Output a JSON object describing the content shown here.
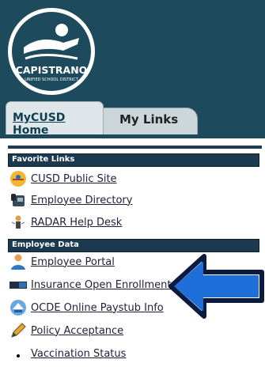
{
  "header": {
    "logo_text": "CAPISTRANO",
    "logo_subtext": "UNIFIED SCHOOL DISTRICT",
    "bg_color": "#1e4a5e"
  },
  "tabs": [
    {
      "label": "MyCUSD Home",
      "active": false
    },
    {
      "label": "My Links",
      "active": true
    }
  ],
  "favorite_links": {
    "heading": "Favorite Links",
    "items": [
      {
        "label": "CUSD Public Site",
        "icon": "cusd-logo-icon"
      },
      {
        "label": "Employee Directory",
        "icon": "phone-icon"
      },
      {
        "label": "RADAR Help Desk",
        "icon": "help-desk-icon"
      }
    ]
  },
  "employee_data": {
    "heading": "Employee Data",
    "items": [
      {
        "label": "Employee Portal",
        "icon": "person-icon"
      },
      {
        "label": "Insurance Open Enrollment",
        "icon": "enroll-icon"
      },
      {
        "label": "OCDE Online Paystub Info",
        "icon": "ocde-icon"
      },
      {
        "label": "Policy Acceptance",
        "icon": "pencil-icon"
      },
      {
        "label": "Vaccination Status",
        "icon": "bullet-icon"
      }
    ]
  },
  "annotation": {
    "arrow_color": "#1e6fd9",
    "icon": "pointer-arrow-icon"
  }
}
